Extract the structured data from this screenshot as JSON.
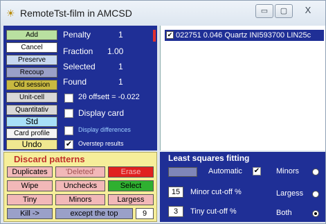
{
  "window": {
    "title": "RemoteTst-film in AMCSD",
    "controls": {
      "minimize": "▭",
      "maximize": "▢",
      "close": "X"
    }
  },
  "left_buttons": [
    {
      "label": "Add",
      "color": "#b9e0a0"
    },
    {
      "label": "Cancel",
      "color": "#ffffff"
    },
    {
      "label": "Preserve",
      "color": "#c8d8f0"
    },
    {
      "label": "Recoup",
      "color": "#9aa0c8"
    },
    {
      "label": "Old session",
      "color": "#c8b840"
    },
    {
      "label": "Unit-cell",
      "color": "#d8d8d8"
    },
    {
      "label": "Quantitativ",
      "color": "#d8d8d8"
    },
    {
      "label": "Std",
      "color": "#a8e0f8"
    },
    {
      "label": "Card profile",
      "color": "#f4f4f4"
    },
    {
      "label": "Undo",
      "color": "#f0e890"
    }
  ],
  "stats": {
    "penalty_label": "Penalty",
    "penalty_value": "1",
    "fraction_label": "Fraction",
    "fraction_value": "1.00",
    "selected_label": "Selected",
    "selected_value": "1",
    "found_label": "Found",
    "found_value": "1"
  },
  "options": {
    "offset": "2θ  offsett = -0.022",
    "display_card": "Display card",
    "display_differences": "Display differences",
    "overstep_results": "Overstep results"
  },
  "list": {
    "items": [
      "022751  0.046  Quartz  INI593700  LIN25c"
    ]
  },
  "discard": {
    "title": "Discard patterns",
    "buttons": {
      "duplicates": "Duplicates",
      "deleted": "'Deleted'",
      "erase": "Erase",
      "wipe": "Wipe",
      "unchecks": "Unchecks",
      "select": "Select",
      "tiny": "Tiny",
      "minors": "Minors",
      "largess": "Largess",
      "kill": "Kill ->",
      "except_top": "except the top",
      "top_value": "9"
    }
  },
  "least_squares": {
    "title": "Least squares  fitting",
    "automatic": "Automatic",
    "minors_label": "Minors",
    "largess_label": "Largess",
    "both_label": "Both",
    "minor_cutoff_value": "15",
    "minor_cutoff_label": "Minor cut-off %",
    "tiny_cutoff_value": "3",
    "tiny_cutoff_label": "Tiny cut-off %",
    "selected_radio": "Both"
  }
}
